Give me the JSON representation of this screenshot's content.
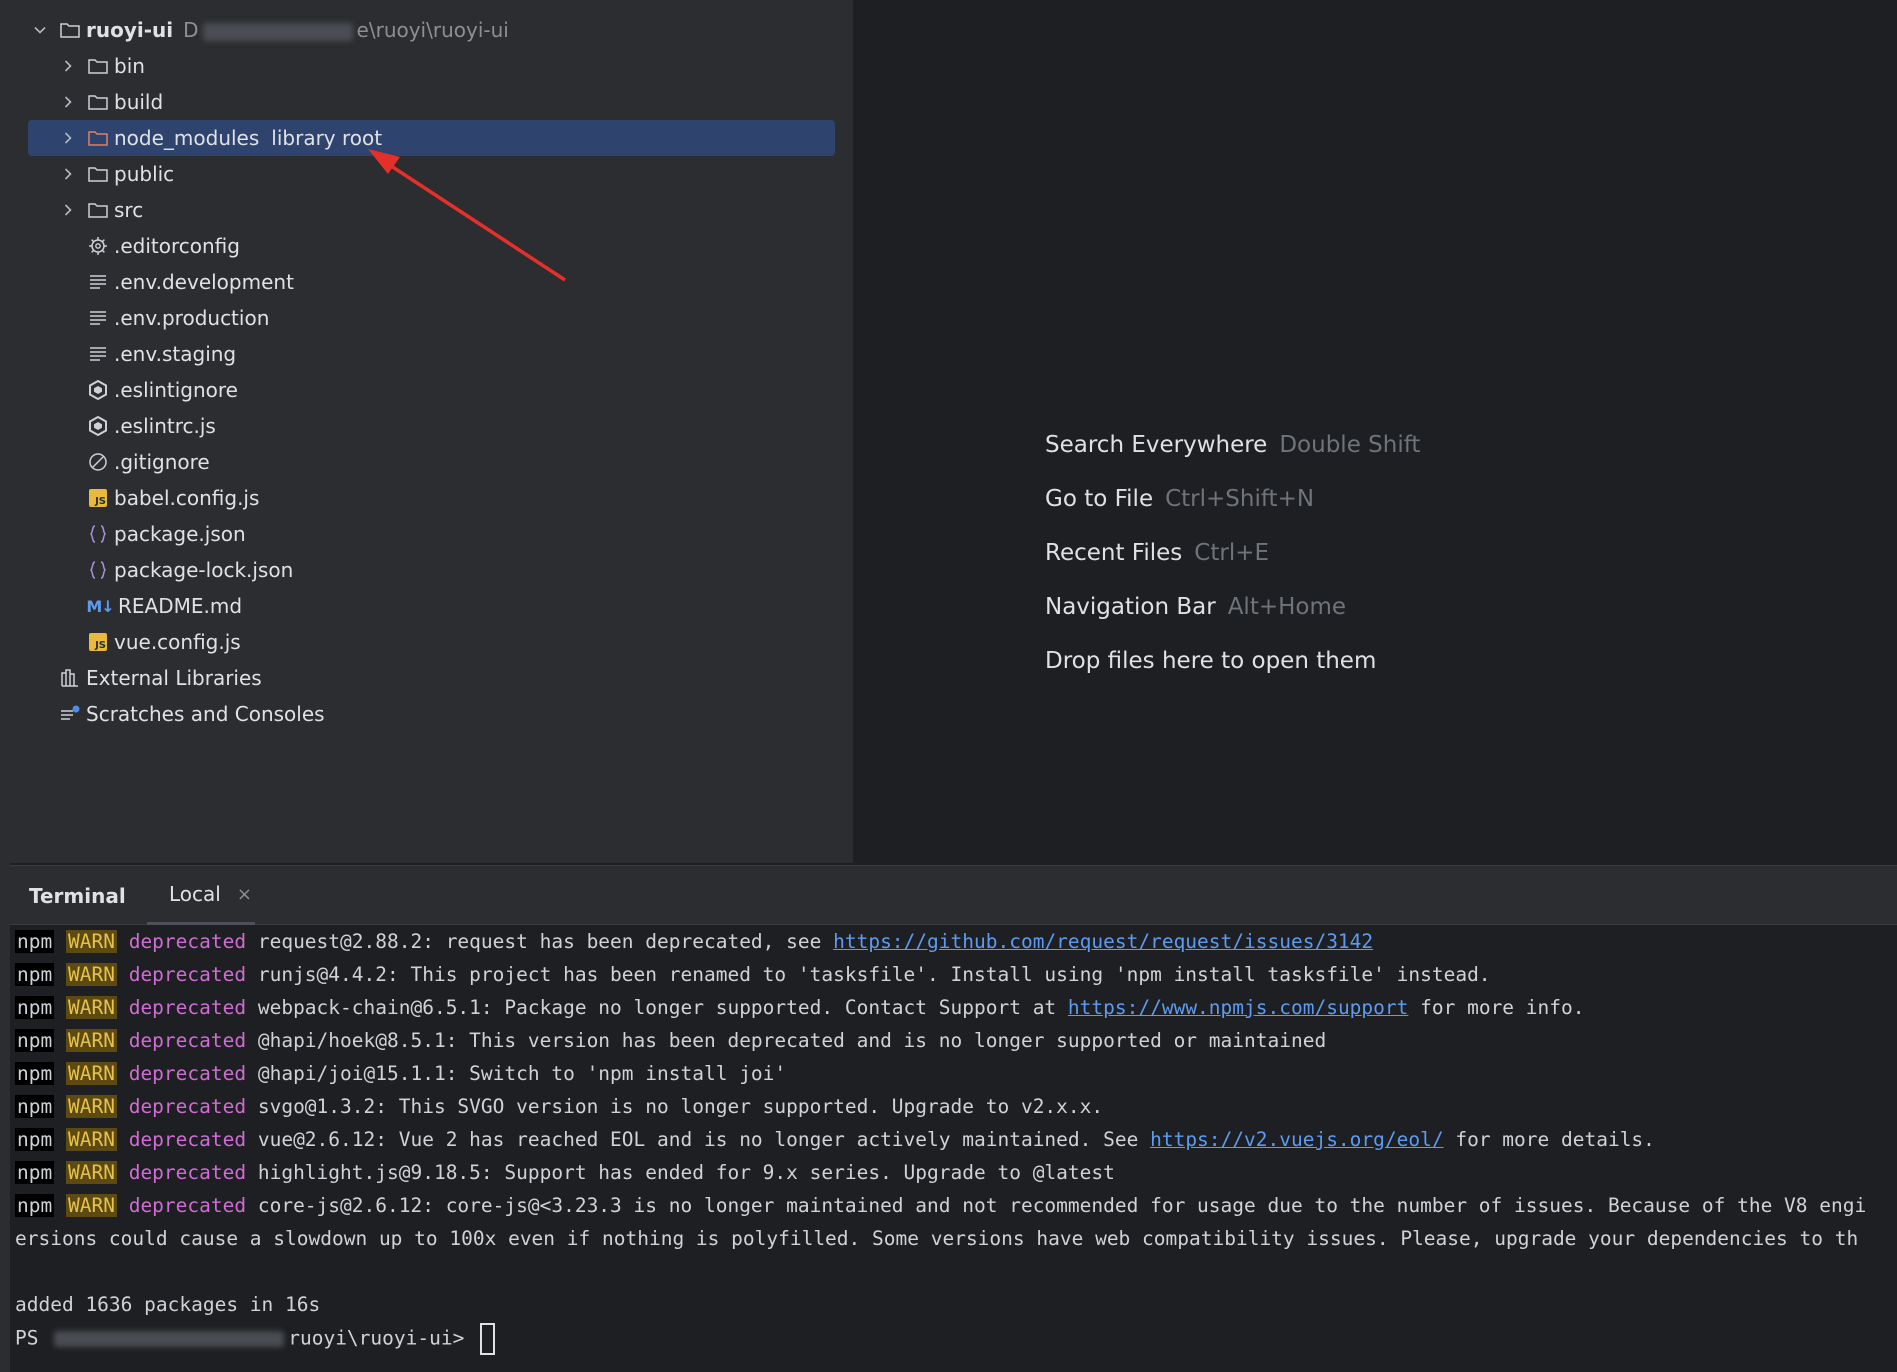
{
  "project": {
    "root_name": "ruoyi-ui",
    "root_path_visible_end": "e\\ruoyi\\ruoyi-ui",
    "root_path_visible_start": "D"
  },
  "tree_items": [
    {
      "label": "bin"
    },
    {
      "label": "build"
    },
    {
      "label": "node_modules",
      "hint": "library root"
    },
    {
      "label": "public"
    },
    {
      "label": "src"
    },
    {
      "label": ".editorconfig"
    },
    {
      "label": ".env.development"
    },
    {
      "label": ".env.production"
    },
    {
      "label": ".env.staging"
    },
    {
      "label": ".eslintignore"
    },
    {
      "label": ".eslintrc.js"
    },
    {
      "label": ".gitignore"
    },
    {
      "label": "babel.config.js"
    },
    {
      "label": "package.json"
    },
    {
      "label": "package-lock.json"
    },
    {
      "label": "README.md"
    },
    {
      "label": "vue.config.js"
    }
  ],
  "external_libraries": "External Libraries",
  "scratches": "Scratches and Consoles",
  "js_badge": "JS",
  "md_badge": "M↓",
  "editor_hints": [
    {
      "label": "Search Everywhere",
      "shortcut": "Double Shift"
    },
    {
      "label": "Go to File",
      "shortcut": "Ctrl+Shift+N"
    },
    {
      "label": "Recent Files",
      "shortcut": "Ctrl+E"
    },
    {
      "label": "Navigation Bar",
      "shortcut": "Alt+Home"
    },
    {
      "label": "Drop files here to open them",
      "shortcut": ""
    }
  ],
  "terminal": {
    "title": "Terminal",
    "tab_label": "Local",
    "close_symbol": "×",
    "npm": "npm",
    "warn": "WARN",
    "deprecated": "deprecated",
    "lines": [
      {
        "text": " request@2.88.2: request has been deprecated, see ",
        "link": "https://github.com/request/request/issues/3142",
        "after": ""
      },
      {
        "text": " runjs@4.4.2: This project has been renamed to 'tasksfile'. Install using 'npm install tasksfile' instead.",
        "link": "",
        "after": ""
      },
      {
        "text": " webpack-chain@6.5.1: Package no longer supported. Contact Support at ",
        "link": "https://www.npmjs.com/support",
        "after": " for more info."
      },
      {
        "text": " @hapi/hoek@8.5.1: This version has been deprecated and is no longer supported or maintained",
        "link": "",
        "after": ""
      },
      {
        "text": " @hapi/joi@15.1.1: Switch to 'npm install joi'",
        "link": "",
        "after": ""
      },
      {
        "text": " svgo@1.3.2: This SVGO version is no longer supported. Upgrade to v2.x.x.",
        "link": "",
        "after": ""
      },
      {
        "text": " vue@2.6.12: Vue 2 has reached EOL and is no longer actively maintained. See ",
        "link": "https://v2.vuejs.org/eol/",
        "after": " for more details."
      },
      {
        "text": " highlight.js@9.18.5: Support has ended for 9.x series. Upgrade to @latest",
        "link": "",
        "after": ""
      },
      {
        "text": " core-js@2.6.12: core-js@<3.23.3 is no longer maintained and not recommended for usage due to the number of issues. Because of the V8 engi",
        "link": "",
        "after": ""
      }
    ],
    "continuation": "ersions could cause a slowdown up to 100x even if nothing is polyfilled. Some versions have web compatibility issues. Please, upgrade your dependencies to th",
    "summary": "added 1636 packages in 16s",
    "prompt_start": "PS ",
    "prompt_end": "ruoyi\\ruoyi-ui> "
  },
  "colors": {
    "selection": "#2e436e",
    "link": "#5e9bf0",
    "warn_bg": "#5c4a12",
    "deprecated": "#d06cd4",
    "arrow": "#e5302a"
  }
}
